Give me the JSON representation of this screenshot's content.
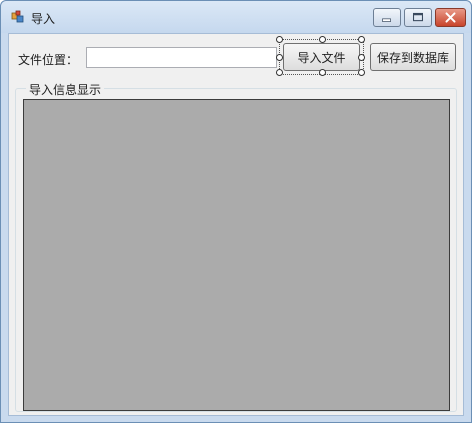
{
  "window": {
    "title": "导入",
    "icon": "app-icon",
    "controls": [
      "minimize-icon",
      "maximize-icon",
      "close-icon"
    ]
  },
  "form": {
    "file_location_label": "文件位置：",
    "file_path_value": "",
    "import_button_label": "导入文件",
    "save_button_label": "保存到数据库"
  },
  "group": {
    "title": "导入信息显示"
  },
  "colors": {
    "grid_background": "#ababab",
    "close_button": "#c8452c",
    "client_background": "#f0f0f0"
  }
}
